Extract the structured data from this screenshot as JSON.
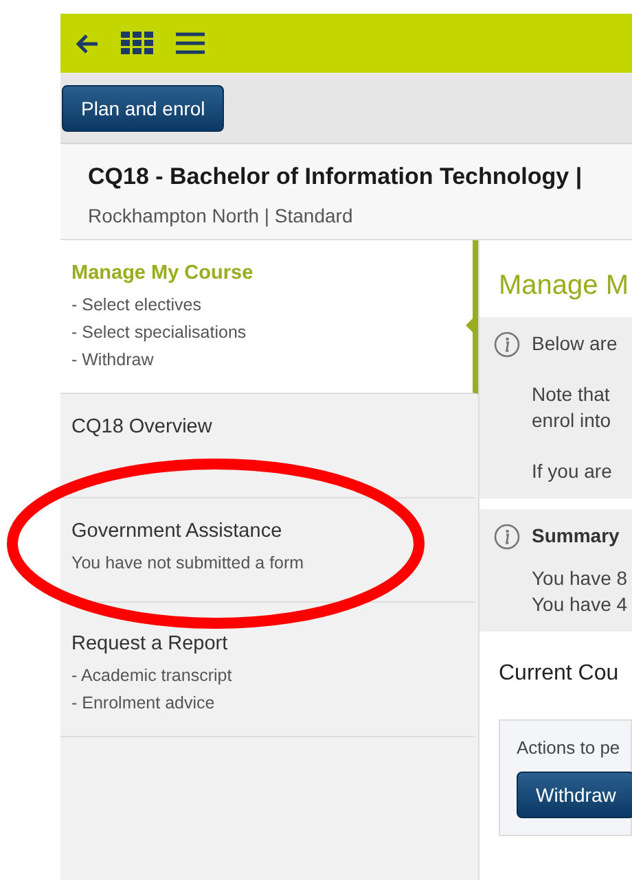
{
  "actions": {
    "button": "Plan and enrol"
  },
  "course": {
    "title": "CQ18 - Bachelor of Information Technology |",
    "subtitle": "Rockhampton North | Standard"
  },
  "sidebar": {
    "items": [
      {
        "title": "Manage My Course",
        "lines": [
          "- Select electives",
          "- Select specialisations",
          "- Withdraw"
        ],
        "selected": true
      },
      {
        "title": "CQ18 Overview",
        "selected": false
      },
      {
        "title": "Government Assistance",
        "lines": [
          "You have not submitted a form"
        ],
        "selected": false
      },
      {
        "title": "Request a Report",
        "lines": [
          "- Academic transcript",
          "- Enrolment advice"
        ],
        "selected": false
      }
    ]
  },
  "main": {
    "heading": "Manage M",
    "info": {
      "paragraphs": [
        [
          "Below are"
        ],
        [
          "Note that",
          "enrol into"
        ],
        [
          "If you are"
        ]
      ]
    },
    "summary": {
      "title": "Summary",
      "lines": [
        "You have 8",
        "You have 4"
      ]
    },
    "section_title": "Current Cou",
    "actions_box": {
      "label": "Actions to pe",
      "button": "Withdraw"
    }
  },
  "annotations": [
    {
      "kind": "ellipse"
    }
  ]
}
